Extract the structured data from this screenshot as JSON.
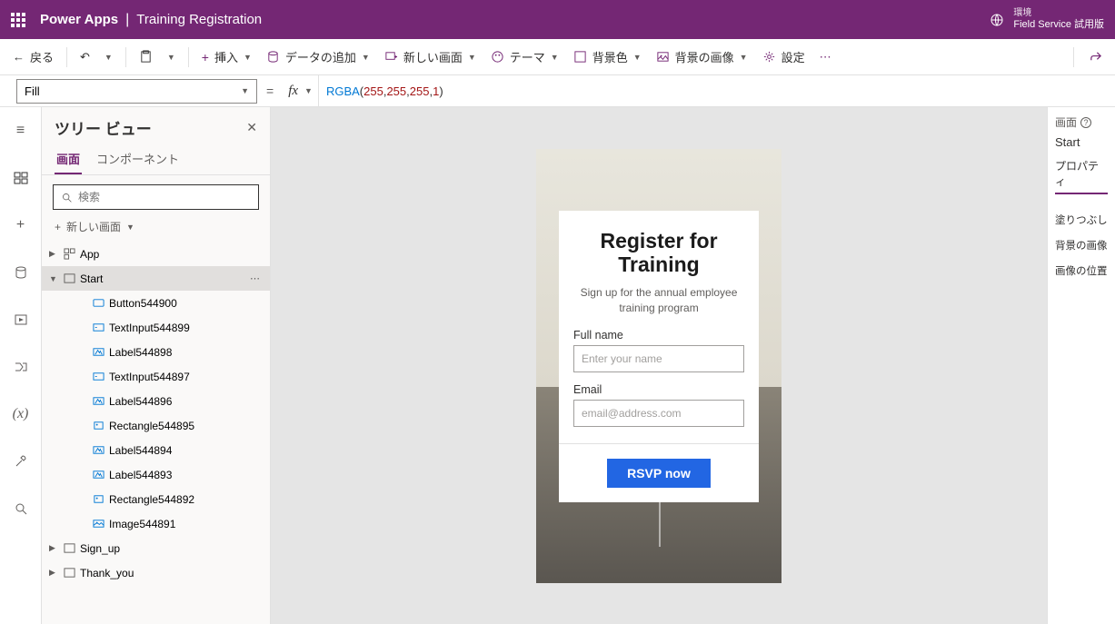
{
  "header": {
    "product": "Power Apps",
    "appname": "Training Registration",
    "env_label": "環境",
    "env_value": "Field Service 試用版"
  },
  "cmdbar": {
    "back": "戻る",
    "insert": "挿入",
    "add_data": "データの追加",
    "new_screen": "新しい画面",
    "theme": "テーマ",
    "bg_color": "背景色",
    "bg_image": "背景の画像",
    "settings": "設定"
  },
  "formula": {
    "property": "Fill",
    "fn": "RGBA",
    "a1": "255",
    "a2": "255",
    "a3": "255",
    "a4": "1"
  },
  "tree": {
    "title": "ツリー ビュー",
    "tab_screen": "画面",
    "tab_component": "コンポーネント",
    "search_placeholder": "検索",
    "new_screen": "新しい画面",
    "app": "App",
    "selected": "Start",
    "children": [
      "Button544900",
      "TextInput544899",
      "Label544898",
      "TextInput544897",
      "Label544896",
      "Rectangle544895",
      "Label544894",
      "Label544893",
      "Rectangle544892",
      "Image544891"
    ],
    "screen2": "Sign_up",
    "screen3": "Thank_you"
  },
  "canvas": {
    "title1": "Register for",
    "title2": "Training",
    "subtitle": "Sign up for the annual employee training program",
    "fullname_label": "Full name",
    "fullname_ph": "Enter your name",
    "email_label": "Email",
    "email_ph": "email@address.com",
    "button": "RSVP now"
  },
  "right": {
    "screen": "画面",
    "start": "Start",
    "properties": "プロパティ",
    "fill": "塗りつぶし",
    "bgimg": "背景の画像",
    "imgpos": "画像の位置"
  }
}
